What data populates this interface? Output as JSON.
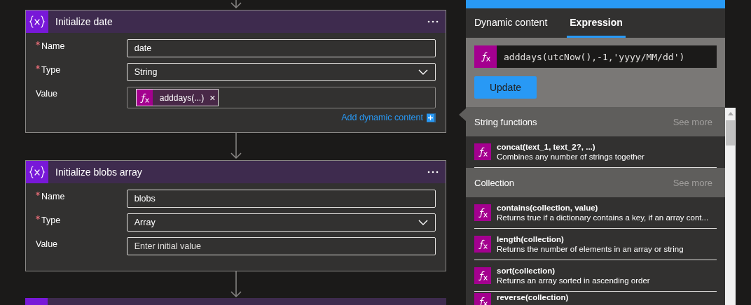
{
  "cards": [
    {
      "title": "Initialize date",
      "fields": [
        {
          "label": "Name",
          "required": true,
          "kind": "text",
          "value": "date"
        },
        {
          "label": "Type",
          "required": true,
          "kind": "select",
          "value": "String"
        },
        {
          "label": "Value",
          "required": false,
          "kind": "token",
          "token": "adddays(...)",
          "remove": "×"
        }
      ],
      "link": "Add dynamic content"
    },
    {
      "title": "Initialize blobs array",
      "fields": [
        {
          "label": "Name",
          "required": true,
          "kind": "text",
          "value": "blobs"
        },
        {
          "label": "Type",
          "required": true,
          "kind": "select",
          "value": "Array"
        },
        {
          "label": "Value",
          "required": false,
          "kind": "text",
          "placeholder": "Enter initial value"
        }
      ]
    }
  ],
  "panel": {
    "tabs": [
      {
        "label": "Dynamic content",
        "selected": false
      },
      {
        "label": "Expression",
        "selected": true
      }
    ],
    "expression": "adddays(utcNow(),-1,'yyyy/MM/dd')",
    "button": "Update",
    "sections": [
      {
        "title": "String functions",
        "see_more": "See more",
        "items": [
          {
            "name": "concat(text_1, text_2?, ...)",
            "description": "Combines any number of strings together"
          }
        ]
      },
      {
        "title": "Collection",
        "see_more": "See more",
        "items": [
          {
            "name": "contains(collection, value)",
            "description": "Returns true if a dictionary contains a key, if an array cont..."
          },
          {
            "name": "length(collection)",
            "description": "Returns the number of elements in an array or string"
          },
          {
            "name": "sort(collection)",
            "description": "Returns an array sorted in ascending order"
          },
          {
            "name": "reverse(collection)"
          }
        ]
      }
    ]
  }
}
